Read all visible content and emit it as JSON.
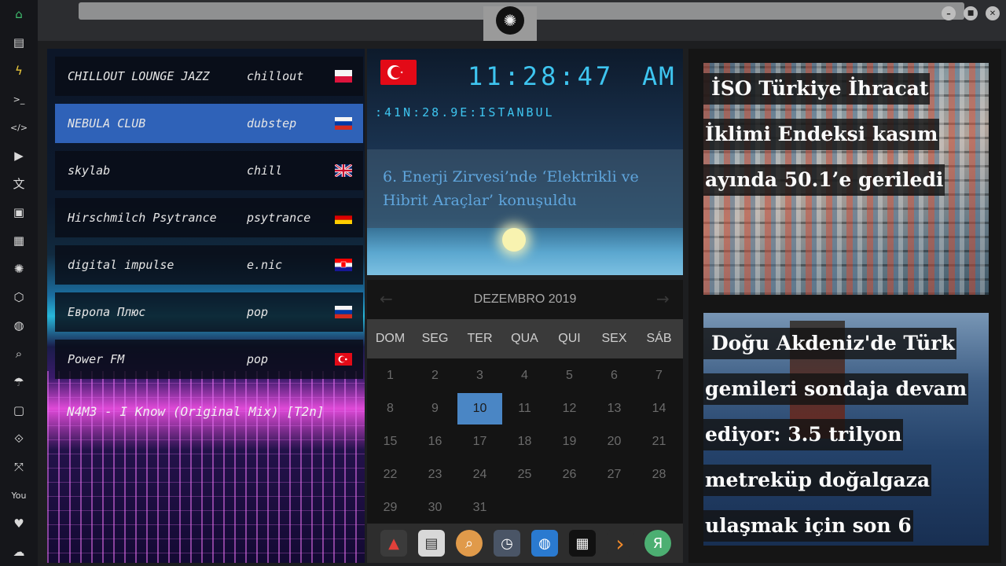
{
  "sidebar": {
    "items": [
      {
        "name": "home-icon",
        "glyph": "⌂"
      },
      {
        "name": "document-icon",
        "glyph": "▤"
      },
      {
        "name": "lightning-icon",
        "glyph": "ϟ"
      },
      {
        "name": "terminal-icon",
        "glyph": ">_"
      },
      {
        "name": "code-icon",
        "glyph": "</>"
      },
      {
        "name": "play-icon",
        "glyph": "▶"
      },
      {
        "name": "translate-icon",
        "glyph": "文"
      },
      {
        "name": "image-icon",
        "glyph": "▣"
      },
      {
        "name": "newspaper-icon",
        "glyph": "▦"
      },
      {
        "name": "rebel-icon",
        "glyph": "✺"
      },
      {
        "name": "hexagon-icon",
        "glyph": "⬡"
      },
      {
        "name": "globe-icon",
        "glyph": "◍"
      },
      {
        "name": "search-icon",
        "glyph": "⌕"
      },
      {
        "name": "umbrella-icon",
        "glyph": "☂"
      },
      {
        "name": "contact-icon",
        "glyph": "▢"
      },
      {
        "name": "link-icon",
        "glyph": "⟐"
      },
      {
        "name": "expand-icon",
        "glyph": "⤧"
      },
      {
        "name": "youtube-icon",
        "glyph": "You"
      },
      {
        "name": "heart-icon",
        "glyph": "♥"
      },
      {
        "name": "cloud-icon",
        "glyph": "☁"
      }
    ]
  },
  "window": {
    "minimize": "–",
    "maximize": "■",
    "close": "✕",
    "logo_glyph": "✺"
  },
  "radio": {
    "stations": [
      {
        "name": "CHILLOUT LOUNGE JAZZ",
        "genre": "chillout",
        "flag": "poland"
      },
      {
        "name": "NEBULA CLUB",
        "genre": "dubstep",
        "flag": "russia"
      },
      {
        "name": "skylab",
        "genre": "chill",
        "flag": "uk"
      },
      {
        "name": "Hirschmilch Psytrance",
        "genre": "psytrance",
        "flag": "germany"
      },
      {
        "name": "digital impulse",
        "genre": "e.nic",
        "flag": "croatia"
      },
      {
        "name": "Европа Плюс",
        "genre": "pop",
        "flag": "russia"
      },
      {
        "name": "Power FM",
        "genre": "pop",
        "flag": "turkey"
      }
    ],
    "active_index": 1,
    "now_playing": "N4M3 - I Know (Original Mix) [T2n]"
  },
  "clock": {
    "time": "11:28:47",
    "ampm": "AM",
    "coords": ":41N:28.9E:ISTANBUL",
    "headline": "6. Enerji Zirvesi’nde ‘Elektrikli ve Hibrit Araçlar’ konuşuldu"
  },
  "calendar": {
    "title": "DEZEMBRO 2019",
    "prev": "←",
    "next": "→",
    "weekdays": [
      "DOM",
      "SEG",
      "TER",
      "QUA",
      "QUI",
      "SEX",
      "SÁB"
    ],
    "today": 10,
    "days_in_month": 31,
    "first_weekday_index": 0
  },
  "dock": {
    "apps": [
      {
        "name": "app-launcher-icon",
        "glyph": "▲",
        "color": "#3b3b3b"
      },
      {
        "name": "news-app-icon",
        "glyph": "▤",
        "color": "#d8d8d8"
      },
      {
        "name": "search-app-icon",
        "glyph": "⌕",
        "color": "#e09a4a"
      },
      {
        "name": "clock-app-icon",
        "glyph": "◷",
        "color": "#4a5566"
      },
      {
        "name": "browser-app-icon",
        "glyph": "◍",
        "color": "#2a7ad0"
      },
      {
        "name": "calendar-app-icon",
        "glyph": "▦",
        "color": "#111111"
      },
      {
        "name": "arrow-app-icon",
        "glyph": "›",
        "color": "#2d2d2d"
      },
      {
        "name": "yandex-app-icon",
        "glyph": "Я",
        "color": "#4caf72"
      }
    ]
  },
  "news": {
    "card1_lines": [
      "İSO Türkiye İhracat",
      "İklimi Endeksi kasım",
      "ayında 50.1’e geriledi"
    ],
    "card2_lines": [
      "Doğu Akdeniz'de Türk",
      "gemileri sondaja devam",
      "ediyor: 3.5 trilyon",
      "metreküp doğalgaza",
      "ulaşmak için son 6"
    ]
  },
  "colors": {
    "accent_clock": "#3ec5f0",
    "active_station": "#2f62b8",
    "calendar_today": "#4a86c5",
    "home_icon": "#3fbf6f",
    "lightning_icon": "#f3cf3c"
  }
}
